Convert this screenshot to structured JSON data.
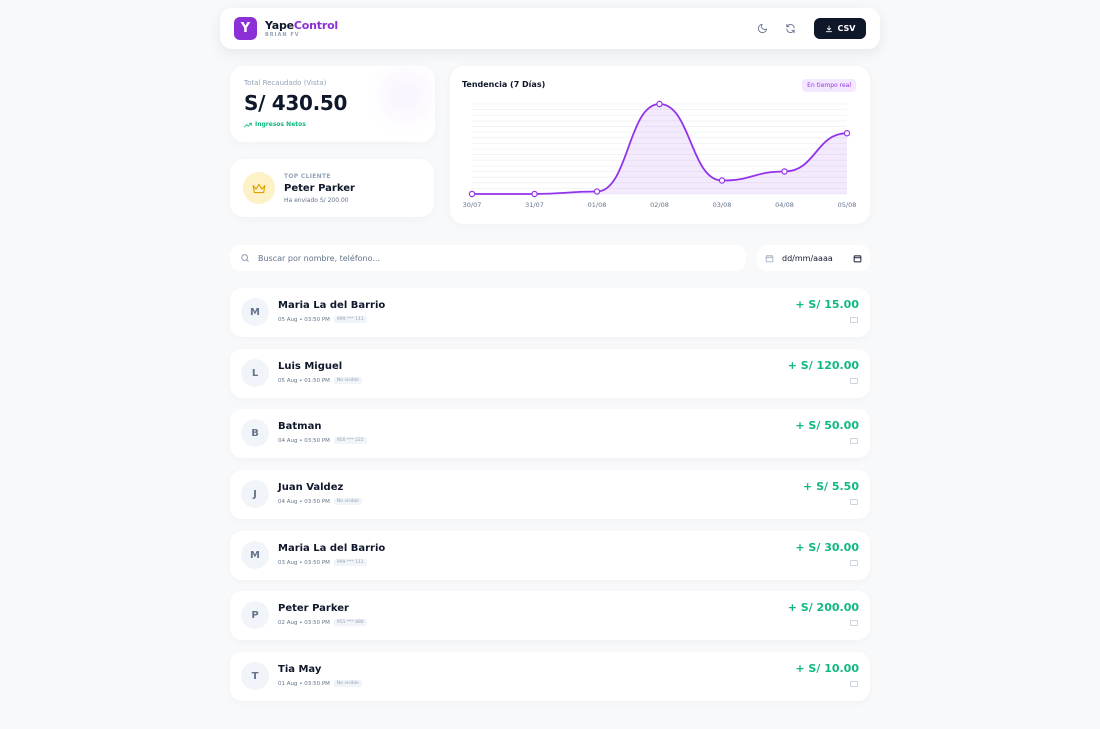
{
  "app": {
    "logo_letter": "Y",
    "title_part1": "Yape",
    "title_part2": "Control",
    "subtitle": "BRIAN FV",
    "csv_label": "CSV",
    "accent": "#8b2fd6"
  },
  "summary": {
    "total_label": "Total Recaudado (Vista)",
    "total_value": "S/ 430.50",
    "total_sub": "Ingresos Netos"
  },
  "top_client": {
    "label": "TOP CLIENTE",
    "name": "Peter Parker",
    "sent": "Ha enviado S/ 200.00"
  },
  "trend": {
    "title": "Tendencia (7 Días)",
    "badge": "En tiempo real"
  },
  "chart_data": {
    "type": "area",
    "categories": [
      "30/07",
      "31/07",
      "01/08",
      "02/08",
      "03/08",
      "04/08",
      "05/08"
    ],
    "values": [
      0,
      0,
      5.5,
      200,
      30,
      50,
      135
    ],
    "ylim": [
      0,
      200
    ],
    "grid": true,
    "color": "#9333ea"
  },
  "search": {
    "placeholder": "Buscar por nombre, teléfono...",
    "date_placeholder": "dd/mm/aaaa"
  },
  "transactions": [
    {
      "initial": "M",
      "name": "Maria La del Barrio",
      "date": "05 Aug • 03:50 PM",
      "tag": "999 *** 111",
      "amount": "+ S/ 15.00"
    },
    {
      "initial": "L",
      "name": "Luis Miguel",
      "date": "05 Aug • 01:50 PM",
      "tag": "No visible",
      "amount": "+ S/ 120.00"
    },
    {
      "initial": "B",
      "name": "Batman",
      "date": "04 Aug • 03:50 PM",
      "tag": "950 *** 222",
      "amount": "+ S/ 50.00"
    },
    {
      "initial": "J",
      "name": "Juan Valdez",
      "date": "04 Aug • 03:50 PM",
      "tag": "No visible",
      "amount": "+ S/ 5.50"
    },
    {
      "initial": "M",
      "name": "Maria La del Barrio",
      "date": "03 Aug • 03:50 PM",
      "tag": "999 *** 111",
      "amount": "+ S/ 30.00"
    },
    {
      "initial": "P",
      "name": "Peter Parker",
      "date": "02 Aug • 03:50 PM",
      "tag": "955 *** 888",
      "amount": "+ S/ 200.00"
    },
    {
      "initial": "T",
      "name": "Tia May",
      "date": "01 Aug • 03:50 PM",
      "tag": "No visible",
      "amount": "+ S/ 10.00"
    }
  ]
}
